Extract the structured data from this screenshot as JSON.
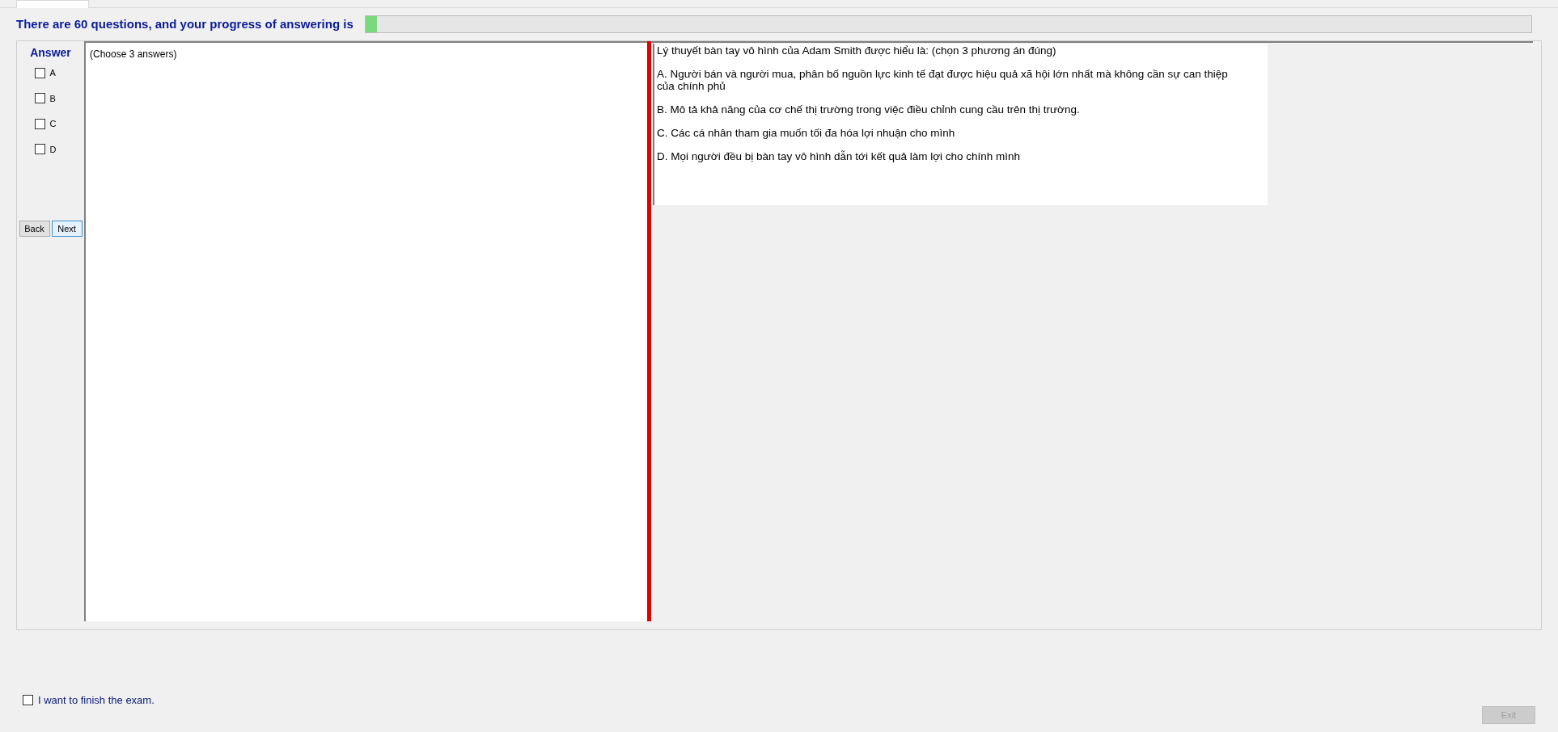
{
  "header": {
    "text": "There are 60 questions, and your progress of answering is",
    "progress": {
      "level": 0.01
    }
  },
  "answer_panel": {
    "title": "Answer",
    "options": [
      {
        "label": "A",
        "checked": false
      },
      {
        "label": "B",
        "checked": false
      },
      {
        "label": "C",
        "checked": false
      },
      {
        "label": "D",
        "checked": false
      }
    ],
    "buttons": [
      {
        "label": "Back",
        "selected": false
      },
      {
        "label": "Next",
        "selected": true
      }
    ]
  },
  "instruction": "(Choose 3 answers)",
  "question": {
    "stem": "Lý thuyết bàn tay vô hình của Adam Smith được hiểu là: (chọn 3 phương án đúng)",
    "choices": [
      "A.  Người bán và người mua, phân bố nguồn lực kinh tế đạt được hiệu quả xã hội lớn nhất mà không cần sự can thiệp của chính phủ",
      "B.  Mô tả khả năng của cơ chế thị trường trong việc điều chỉnh cung cầu trên thị trường.",
      "C.  Các cá nhân tham gia muốn tối đa hóa lợi nhuận cho mình",
      "D.  Mọi người đều bị bàn tay vô hình dẫn  tới kết quả làm lợi cho chính mình"
    ]
  },
  "finish": {
    "label": "I want to finish the exam.",
    "checked": false
  },
  "exit_button": {
    "label": "Exit",
    "disabled": true
  }
}
